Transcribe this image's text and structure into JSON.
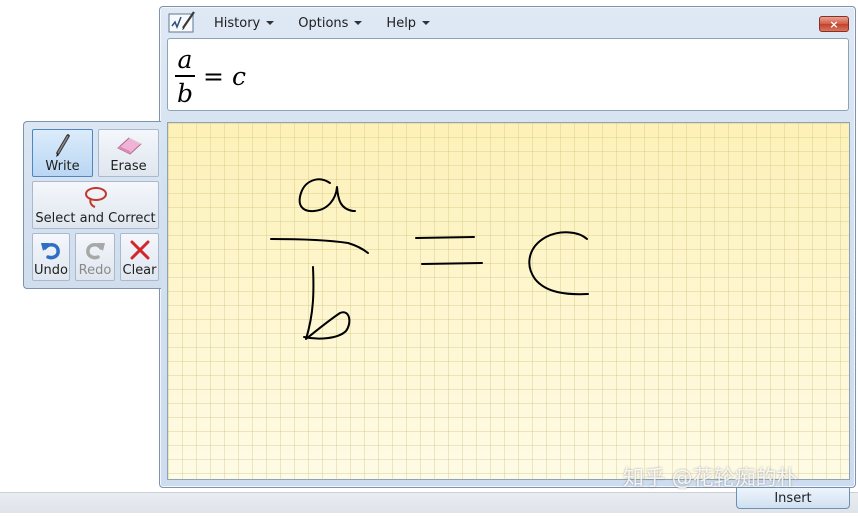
{
  "menu": {
    "history": "History",
    "options": "Options",
    "help": "Help",
    "close_symbol": "×"
  },
  "preview": {
    "numerator": "a",
    "denominator": "b",
    "equals": "=",
    "rhs": "c"
  },
  "tools": {
    "write": "Write",
    "erase": "Erase",
    "select_correct": "Select and Correct",
    "undo": "Undo",
    "redo": "Redo",
    "clear": "Clear"
  },
  "insert_label": "Insert",
  "watermark": "知乎 @花轮痴的朴",
  "icons": {
    "app": "math-input-panel-icon",
    "write": "pen-icon",
    "erase": "eraser-icon",
    "select_correct": "lasso-icon",
    "undo": "undo-icon",
    "redo": "redo-icon",
    "clear": "clear-x-icon"
  },
  "colors": {
    "ink": "#000000",
    "writing_bg": "#fef6c8",
    "chrome": "#d3e1f0",
    "close": "#c0432b",
    "clear_x": "#d2262b",
    "undo_arrow": "#2c6fc4"
  }
}
